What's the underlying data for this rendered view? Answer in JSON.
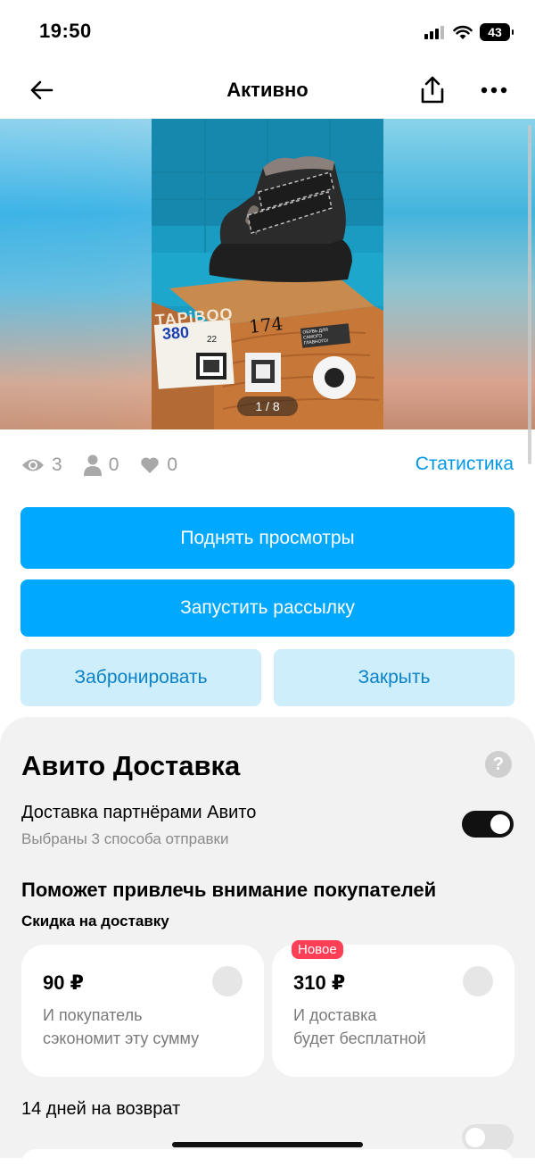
{
  "status_bar": {
    "time": "19:50",
    "battery": "43"
  },
  "nav": {
    "title": "Активно"
  },
  "gallery": {
    "counter": "1 / 8",
    "box_brand": "TAPiBOO",
    "box_note": "380",
    "box_mark": "174",
    "box_size": "22",
    "box_sticker": "ОБУВЬ ДЛЯ САМОГО ГЛАВНОГО!"
  },
  "stats": {
    "views": "3",
    "contacts": "0",
    "favorites": "0",
    "link": "Статистика"
  },
  "actions": {
    "raise": "Поднять просмотры",
    "mailing": "Запустить рассылку",
    "reserve": "Забронировать",
    "close": "Закрыть"
  },
  "delivery": {
    "title": "Авито Доставка",
    "help": "?",
    "partner_label": "Доставка партнёрами Авито",
    "partner_sub": "Выбраны 3 способа отправки",
    "partner_enabled": true,
    "attract_title": "Поможет привлечь внимание покупателей",
    "discount_label": "Скидка на доставку",
    "options": [
      {
        "price": "90 ₽",
        "line1": "И покупатель",
        "line2": "сэкономит эту сумму",
        "badge": ""
      },
      {
        "price": "310 ₽",
        "line1": "И доставка",
        "line2": "будет бесплатной",
        "badge": "Новое"
      }
    ],
    "return_label": "14 дней на возврат",
    "return_enabled": false
  },
  "colors": {
    "accent": "#00a8ff",
    "link": "#0098e6",
    "secondary_bg": "#cfeefc",
    "badge": "#ff3f55"
  }
}
